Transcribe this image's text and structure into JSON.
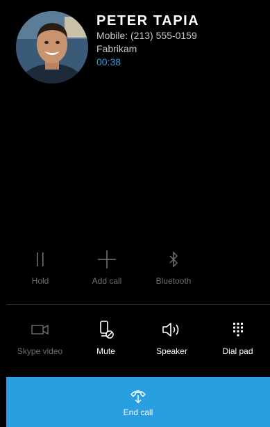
{
  "caller": {
    "name": "PETER TAPIA",
    "phone": "Mobile: (213) 555-0159",
    "company": "Fabrikam",
    "timer": "00:38"
  },
  "controls_top": [
    {
      "label": "Hold",
      "icon": "pause-icon",
      "enabled": false
    },
    {
      "label": "Add call",
      "icon": "plus-icon",
      "enabled": false
    },
    {
      "label": "Bluetooth",
      "icon": "bluetooth-icon",
      "enabled": false
    }
  ],
  "controls_bottom": [
    {
      "label": "Skype video",
      "icon": "video-camera-icon",
      "enabled": false
    },
    {
      "label": "Mute",
      "icon": "microphone-muted-icon",
      "enabled": true
    },
    {
      "label": "Speaker",
      "icon": "speaker-icon",
      "enabled": true
    },
    {
      "label": "Dial pad",
      "icon": "dialpad-icon",
      "enabled": true
    }
  ],
  "end_call": {
    "label": "End call",
    "icon": "hang-up-icon"
  },
  "colors": {
    "accent": "#2a9fe0",
    "background": "#000000",
    "disabled_text": "#6f6f6f"
  }
}
